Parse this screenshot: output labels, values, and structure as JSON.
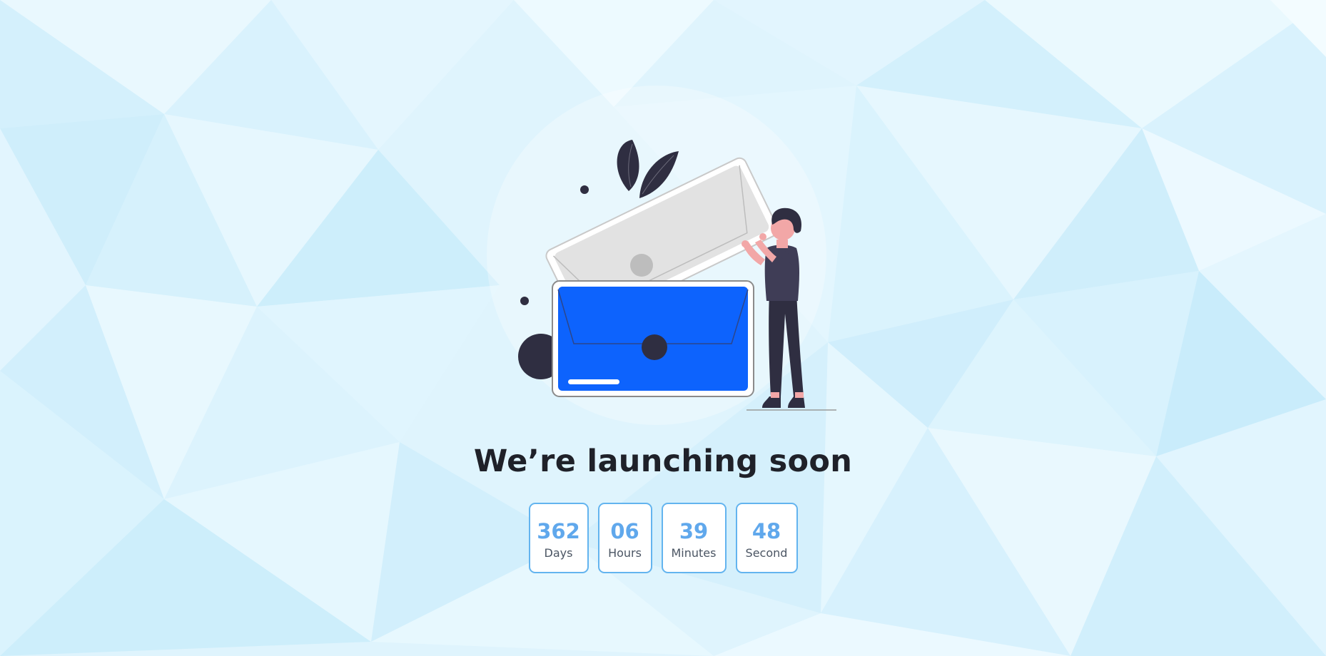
{
  "heading": "We’re launching soon",
  "countdown": [
    {
      "value": "362",
      "unit": "Days"
    },
    {
      "value": "06",
      "unit": "Hours"
    },
    {
      "value": "39",
      "unit": "Minutes"
    },
    {
      "value": "48",
      "unit": "Second"
    }
  ],
  "colors": {
    "background": "#dff4fd",
    "accent_blue": "#0d63fd",
    "countdown_number": "#60a8ec",
    "tile_border": "#63b4ef",
    "heading_text": "#1f2129",
    "dark_figure": "#2f2e41"
  },
  "illustration": {
    "icon": "open-envelope-with-person-illustration"
  }
}
